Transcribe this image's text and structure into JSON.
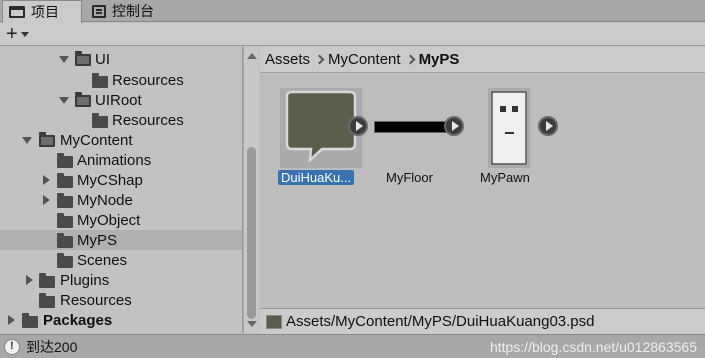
{
  "tabs": [
    {
      "label": "项目",
      "icon": "folder-icon",
      "active": true
    },
    {
      "label": "控制台",
      "icon": "console-icon",
      "active": false
    }
  ],
  "toolbar": {
    "add_label": "+"
  },
  "tree": [
    {
      "label": "UI",
      "indent": 4,
      "expanded": true,
      "open": true
    },
    {
      "label": "Resources",
      "indent": 5
    },
    {
      "label": "UIRoot",
      "indent": 4,
      "expanded": true,
      "open": true
    },
    {
      "label": "Resources",
      "indent": 5
    },
    {
      "label": "MyContent",
      "indent": 2,
      "expanded": true,
      "open": true
    },
    {
      "label": "Animations",
      "indent": 3
    },
    {
      "label": "MyCShap",
      "indent": 3,
      "collapsed": true
    },
    {
      "label": "MyNode",
      "indent": 3,
      "collapsed": true
    },
    {
      "label": "MyObject",
      "indent": 3
    },
    {
      "label": "MyPS",
      "indent": 3,
      "selected": true
    },
    {
      "label": "Scenes",
      "indent": 3
    },
    {
      "label": "Plugins",
      "indent": 2,
      "collapsed": true
    },
    {
      "label": "Resources",
      "indent": 2
    },
    {
      "label": "Packages",
      "indent": 1,
      "collapsed": true,
      "bold": true
    }
  ],
  "breadcrumb": [
    "Assets",
    "MyContent",
    "MyPS"
  ],
  "assets": [
    {
      "name": "DuiHuaKu...",
      "selected": true
    },
    {
      "name": "MyFloor"
    },
    {
      "name": "MyPawn"
    }
  ],
  "selected_path": "Assets/MyContent/MyPS/DuiHuaKuang03.psd",
  "status": {
    "message": "到达200"
  },
  "watermark": "https://blog.csdn.net/u012863565",
  "colors": {
    "selection": "#3a72b0",
    "panel": "#c2c2c2"
  }
}
